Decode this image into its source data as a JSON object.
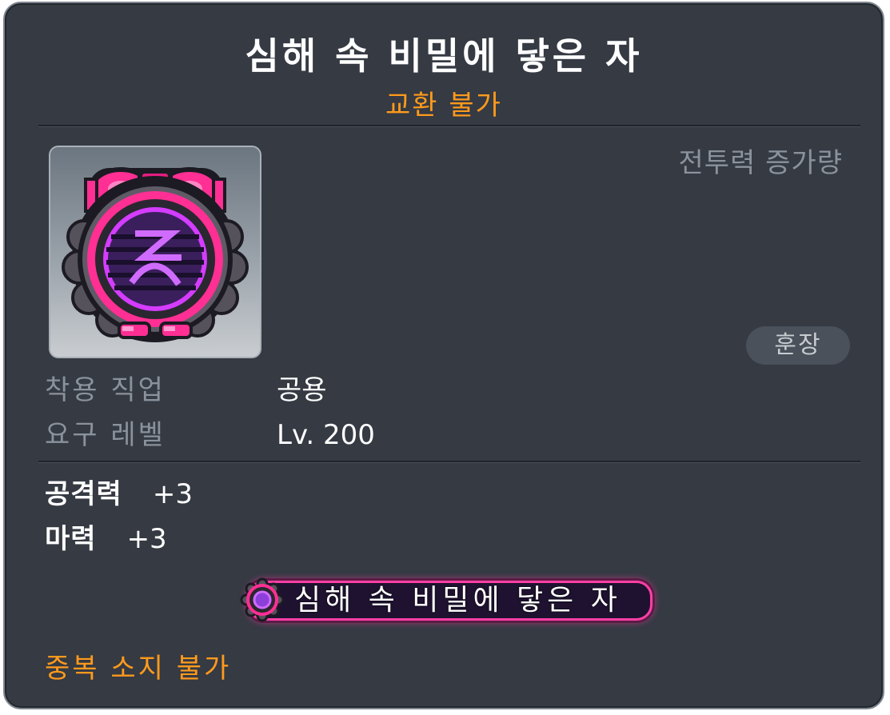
{
  "item": {
    "name": "심해 속 비밀에 닿은 자",
    "trade_status": "교환 불가",
    "power_label": "전투력 증가량",
    "category_badge": "훈장"
  },
  "requirements": {
    "job_label": "착용 직업",
    "job_value": "공용",
    "level_label": "요구 레벨",
    "level_value": "Lv. 200"
  },
  "stats": [
    {
      "label": "공격력",
      "value": "+3"
    },
    {
      "label": "마력",
      "value": "+3"
    }
  ],
  "nametag": {
    "text": "심해 속 비밀에 닿은 자",
    "icon": "gear-icon"
  },
  "note": "중복 소지 불가",
  "colors": {
    "background": "#353a43",
    "accent_orange": "#ff9a1c",
    "label_gray": "#8a929c",
    "nametag_pink": "#ff3fa6",
    "nametag_fill": "#1e1230"
  },
  "icons": {
    "item": "medal-icon"
  }
}
